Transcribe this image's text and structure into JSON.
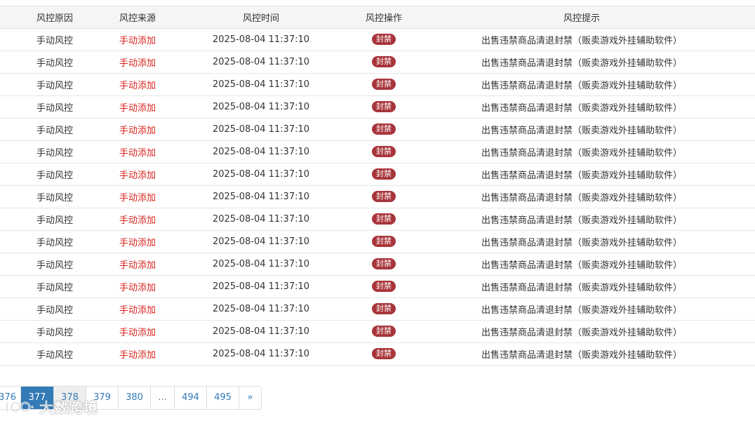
{
  "table": {
    "headers": {
      "reason": "风控原因",
      "source": "风控来源",
      "time": "风控时间",
      "action": "风控操作",
      "tip": "风控提示"
    },
    "rows": [
      {
        "reason": "手动风控",
        "source": "手动添加",
        "time": "2025-08-04 11:37:10",
        "action": "封禁",
        "tip": "出售违禁商品清退封禁（贩卖游戏外挂辅助软件）"
      },
      {
        "reason": "手动风控",
        "source": "手动添加",
        "time": "2025-08-04 11:37:10",
        "action": "封禁",
        "tip": "出售违禁商品清退封禁（贩卖游戏外挂辅助软件）"
      },
      {
        "reason": "手动风控",
        "source": "手动添加",
        "time": "2025-08-04 11:37:10",
        "action": "封禁",
        "tip": "出售违禁商品清退封禁（贩卖游戏外挂辅助软件）"
      },
      {
        "reason": "手动风控",
        "source": "手动添加",
        "time": "2025-08-04 11:37:10",
        "action": "封禁",
        "tip": "出售违禁商品清退封禁（贩卖游戏外挂辅助软件）"
      },
      {
        "reason": "手动风控",
        "source": "手动添加",
        "time": "2025-08-04 11:37:10",
        "action": "封禁",
        "tip": "出售违禁商品清退封禁（贩卖游戏外挂辅助软件）"
      },
      {
        "reason": "手动风控",
        "source": "手动添加",
        "time": "2025-08-04 11:37:10",
        "action": "封禁",
        "tip": "出售违禁商品清退封禁（贩卖游戏外挂辅助软件）"
      },
      {
        "reason": "手动风控",
        "source": "手动添加",
        "time": "2025-08-04 11:37:10",
        "action": "封禁",
        "tip": "出售违禁商品清退封禁（贩卖游戏外挂辅助软件）"
      },
      {
        "reason": "手动风控",
        "source": "手动添加",
        "time": "2025-08-04 11:37:10",
        "action": "封禁",
        "tip": "出售违禁商品清退封禁（贩卖游戏外挂辅助软件）"
      },
      {
        "reason": "手动风控",
        "source": "手动添加",
        "time": "2025-08-04 11:37:10",
        "action": "封禁",
        "tip": "出售违禁商品清退封禁（贩卖游戏外挂辅助软件）"
      },
      {
        "reason": "手动风控",
        "source": "手动添加",
        "time": "2025-08-04 11:37:10",
        "action": "封禁",
        "tip": "出售违禁商品清退封禁（贩卖游戏外挂辅助软件）"
      },
      {
        "reason": "手动风控",
        "source": "手动添加",
        "time": "2025-08-04 11:37:10",
        "action": "封禁",
        "tip": "出售违禁商品清退封禁（贩卖游戏外挂辅助软件）"
      },
      {
        "reason": "手动风控",
        "source": "手动添加",
        "time": "2025-08-04 11:37:10",
        "action": "封禁",
        "tip": "出售违禁商品清退封禁（贩卖游戏外挂辅助软件）"
      },
      {
        "reason": "手动风控",
        "source": "手动添加",
        "time": "2025-08-04 11:37:10",
        "action": "封禁",
        "tip": "出售违禁商品清退封禁（贩卖游戏外挂辅助软件）"
      },
      {
        "reason": "手动风控",
        "source": "手动添加",
        "time": "2025-08-04 11:37:10",
        "action": "封禁",
        "tip": "出售违禁商品清退封禁（贩卖游戏外挂辅助软件）"
      },
      {
        "reason": "手动风控",
        "source": "手动添加",
        "time": "2025-08-04 11:37:10",
        "action": "封禁",
        "tip": "出售违禁商品清退封禁（贩卖游戏外挂辅助软件）"
      }
    ]
  },
  "pagination": {
    "pages": [
      "376",
      "377",
      "378",
      "379",
      "380",
      "...",
      "494",
      "495",
      "»"
    ],
    "active": "377",
    "hover": "378"
  },
  "colors": {
    "source_text": "#d9231d",
    "ban_badge": "#a8353a",
    "active_page": "#337ab7",
    "link": "#337ab7"
  },
  "watermark": {
    "text": "大数跨境",
    "icon": "logo-mark"
  }
}
